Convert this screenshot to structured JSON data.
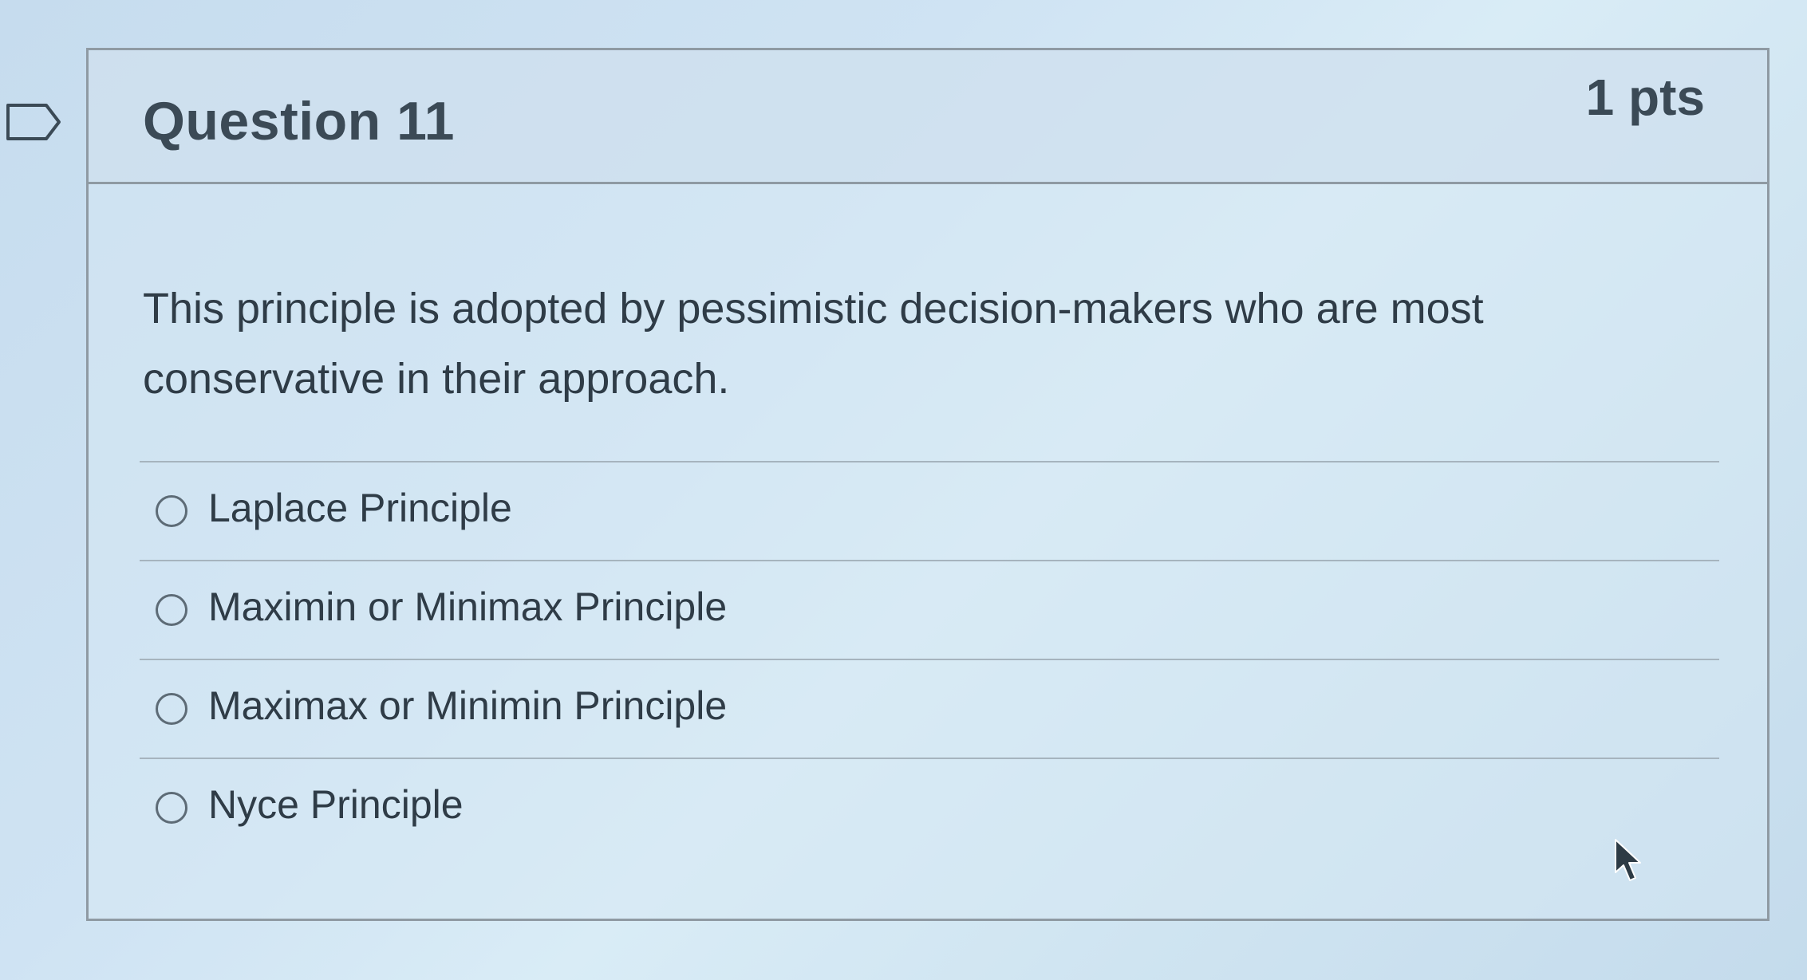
{
  "question": {
    "title": "Question 11",
    "points": "1 pts",
    "text": "This principle is adopted by pessimistic decision-makers who are most conservative in their approach."
  },
  "answers": [
    {
      "label": "Laplace Principle",
      "selected": false
    },
    {
      "label": "Maximin or Minimax Principle",
      "selected": false
    },
    {
      "label": "Maximax or Minimin Principle",
      "selected": false
    },
    {
      "label": "Nyce Principle",
      "selected": false
    }
  ],
  "icons": {
    "flag": "flag-icon",
    "radio": "radio-icon",
    "cursor": "mouse-pointer-icon"
  },
  "colors": {
    "text": "#2f3c47",
    "border": "#8f9aa3",
    "background": "#cfe3f3"
  }
}
